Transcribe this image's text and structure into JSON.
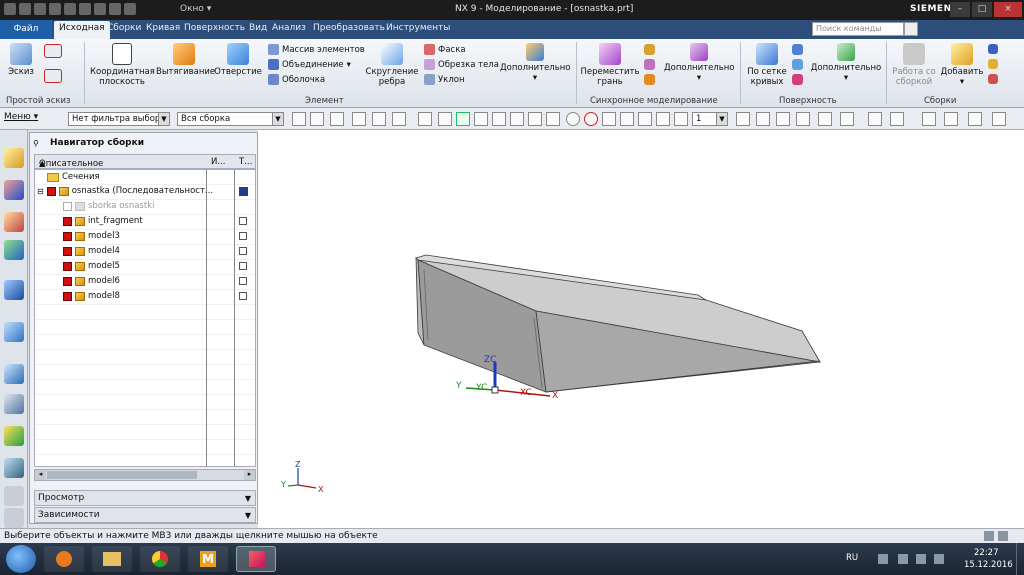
{
  "window": {
    "title": "NX 9 - Моделирование - [osnastka.prt]",
    "brand": "SIEMENS",
    "window_menu": "Окно",
    "window_menu_arrow": "▾"
  },
  "menu_tabs": {
    "file": "Файл",
    "items": [
      "Исходная",
      "Сборки",
      "Кривая",
      "Поверхность",
      "Вид",
      "Анализ",
      "Преобразовать",
      "Инструменты"
    ],
    "search_placeholder": "Поиск команды"
  },
  "ribbon": {
    "sketch": "Эскиз",
    "group_direct_sketch": "Простой эскиз",
    "coord_plane_1": "Координатная",
    "coord_plane_2": "плоскость",
    "extrude": "Вытягивание",
    "hole": "Отверстие",
    "pattern": "Массив элементов",
    "unite": "Объединение",
    "shell": "Оболочка",
    "edge_blend_1": "Скругление",
    "edge_blend_2": "ребра",
    "chamfer": "Фаска",
    "trim_body": "Обрезка тела",
    "draft": "Уклон",
    "more": "Дополнительно",
    "group_feature": "Элемент",
    "move_face_1": "Переместить",
    "move_face_2": "грань",
    "group_sync": "Синхронное моделирование",
    "through_curves_1": "По сетке",
    "through_curves_2": "кривых",
    "group_surface": "Поверхность",
    "work_assembly_1": "Работа со",
    "work_assembly_2": "сборкой",
    "add": "Добавить",
    "group_assemblies": "Сборки"
  },
  "selection_bar": {
    "menu": "Меню",
    "filter": "Нет фильтра выбор",
    "scope": "Вся сборка",
    "layer": "1"
  },
  "navigator": {
    "title": "Навигатор сборки",
    "col_name": "Описательное имя детали",
    "col_i": "И...",
    "col_t": "Т...",
    "sections": "Сечения",
    "root": "osnastka (Последовательност...",
    "suppressed": "sborka osnastki",
    "items": [
      "int_fragment",
      "model3",
      "model4",
      "model5",
      "model6",
      "model8"
    ],
    "preview": "Просмотр",
    "dependencies": "Зависимости"
  },
  "triad": {
    "zc": "ZC",
    "yc": "YC",
    "xc": "XC",
    "z": "Z",
    "y": "Y",
    "x": "X"
  },
  "status": {
    "prompt": "Выберите объекты и нажмите MB3 или дважды щелкните мышью на объекте"
  },
  "taskbar": {
    "lang": "RU",
    "time": "22:27",
    "date": "15.12.2016"
  }
}
